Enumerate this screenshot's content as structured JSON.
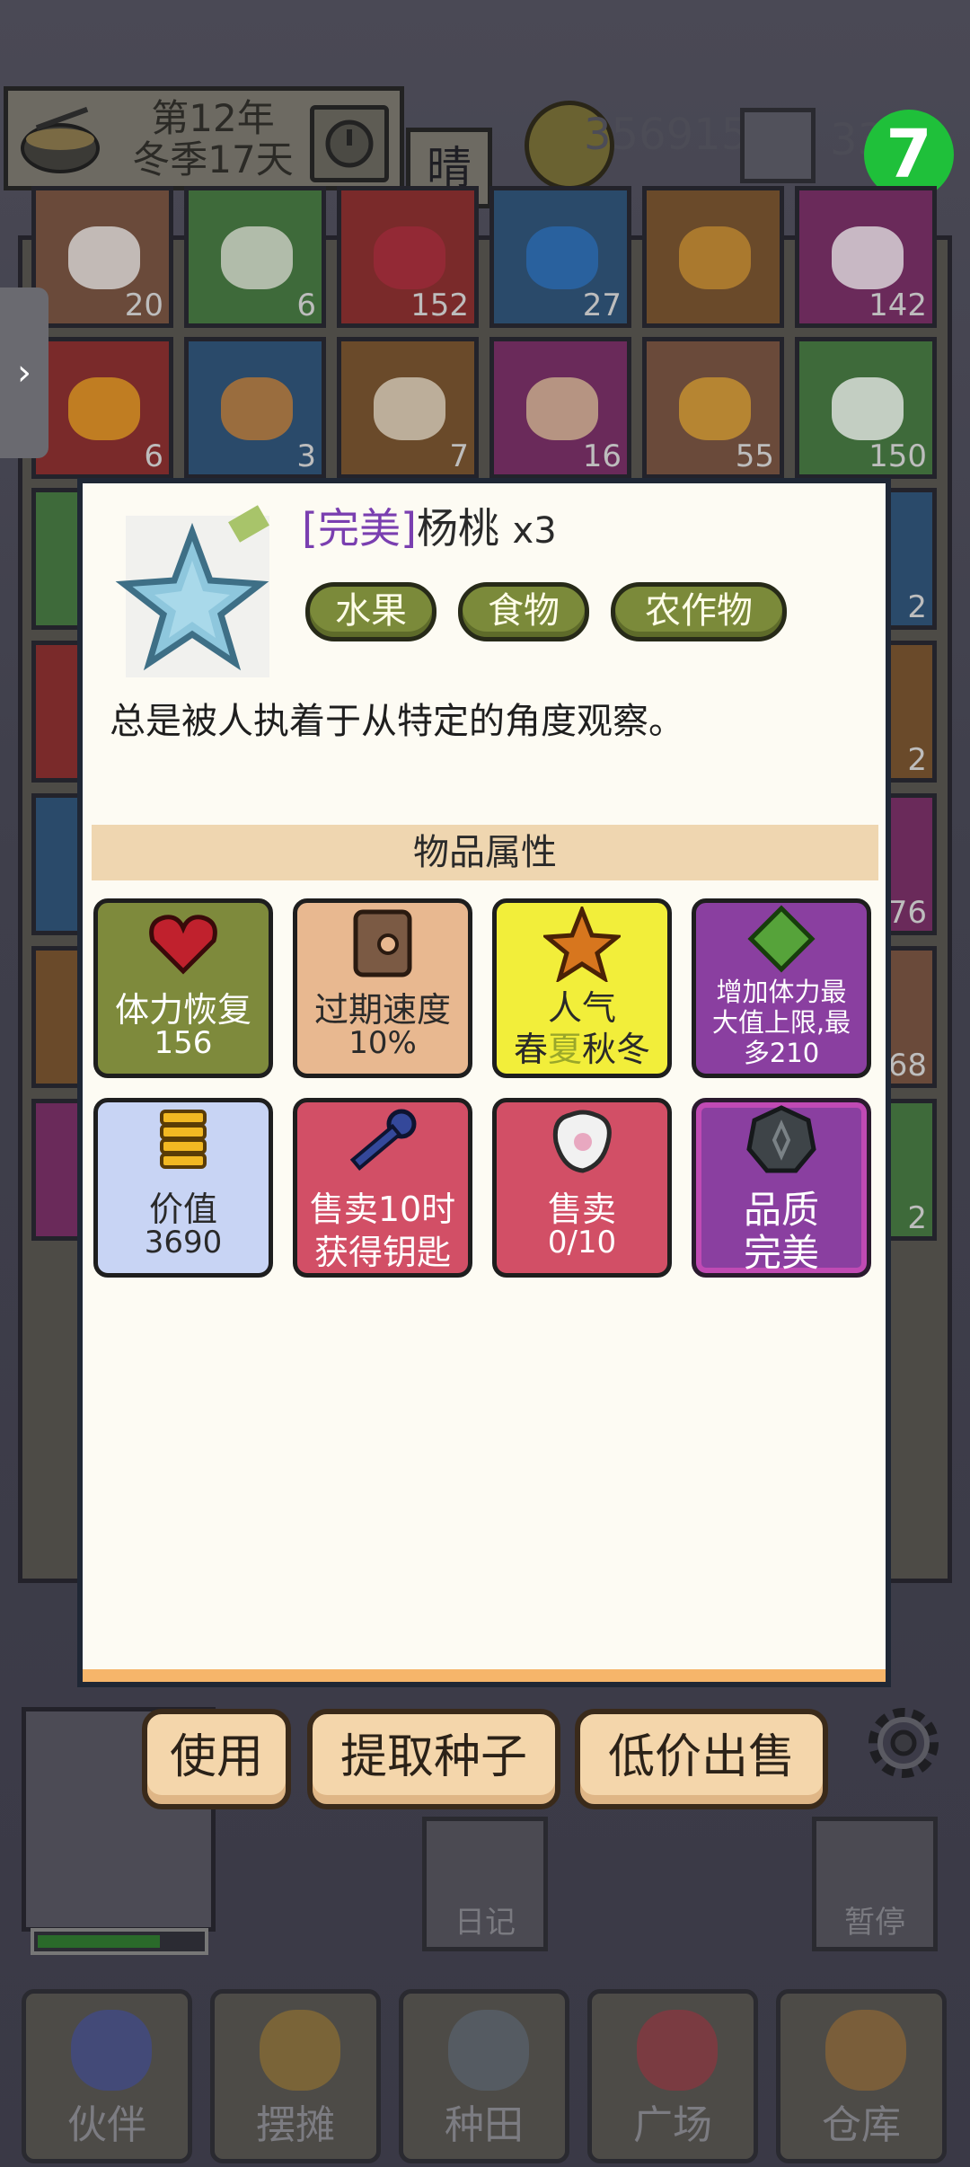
{
  "header": {
    "year": "第12年",
    "season_day": "冬季17天",
    "weather": "晴",
    "coins": "356915",
    "gems": "33",
    "badge": "7"
  },
  "inventory": {
    "counts_row1": [
      "20",
      "6",
      "152",
      "27",
      "",
      "142"
    ],
    "counts_row2": [
      "6",
      "3",
      "7",
      "16",
      "55",
      "150"
    ],
    "side_counts": [
      "2",
      "2",
      "76",
      "68",
      "2"
    ]
  },
  "modal": {
    "quality": "[完美]",
    "item_name": "杨桃",
    "item_count": "x3",
    "tags": [
      "水果",
      "食物",
      "农作物"
    ],
    "description": "总是被人执着于从特定的角度观察。",
    "section_title": "物品属性",
    "attributes": [
      {
        "line1": "体力恢复",
        "line2": "156",
        "icon": "heart-icon",
        "color": "#7e8a3c"
      },
      {
        "line1": "过期速度",
        "line2": "10%",
        "icon": "clock-icon",
        "color": "#e8b890"
      },
      {
        "line1": "人气",
        "line2_a": "春",
        "line2_b": "夏",
        "line2_c": "秋冬",
        "icon": "star-icon",
        "color": "#f2ee3a"
      },
      {
        "line1": "增加体力最",
        "line2": "大值上限,最",
        "line3": "多210",
        "icon": "green-gem-icon",
        "color": "#8a3fa0"
      },
      {
        "line1": "价值",
        "line2": "3690",
        "icon": "coin-stack-icon",
        "color": "#c8d4f4"
      },
      {
        "line1": "售卖10时",
        "line2": "获得钥匙",
        "icon": "key-icon",
        "color": "#d24f66"
      },
      {
        "line1": "售卖",
        "line2": "0/10",
        "icon": "glove-icon",
        "color": "#d24f66"
      },
      {
        "line1": "品质",
        "line2": "完美",
        "icon": "quality-medal-icon",
        "color": "#8a3fa0"
      }
    ]
  },
  "actions": {
    "use": "使用",
    "extract_seed": "提取种子",
    "sell_cheap": "低价出售"
  },
  "bottom": {
    "diary": "日记",
    "pause": "暂停",
    "nav": [
      "伙伴",
      "摆摊",
      "种田",
      "广场",
      "仓库"
    ]
  }
}
